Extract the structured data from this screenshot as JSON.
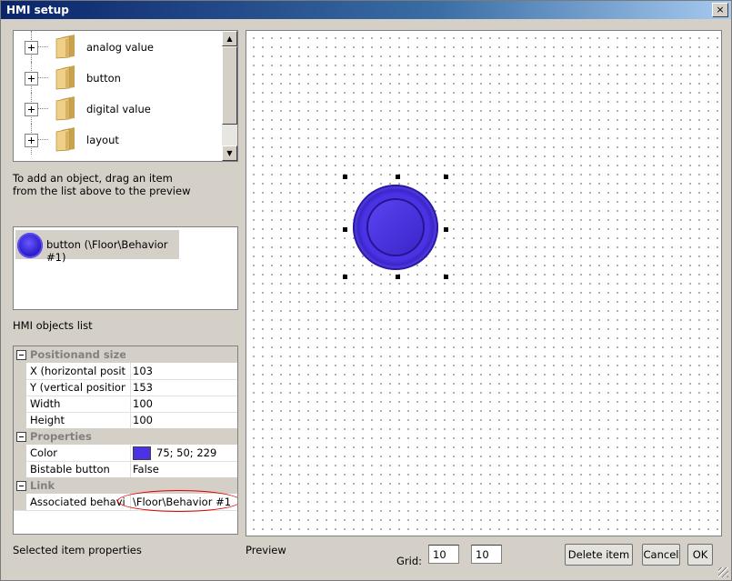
{
  "window": {
    "title": "HMI setup",
    "close_label": "×"
  },
  "tree": {
    "items": [
      {
        "label": "analog value",
        "icon": "folder-icon"
      },
      {
        "label": "button",
        "icon": "folder-icon"
      },
      {
        "label": "digital value",
        "icon": "folder-icon"
      },
      {
        "label": "layout",
        "icon": "folder-icon"
      }
    ]
  },
  "hint": "To add an object, drag an item from the list above to the preview",
  "objects_list": {
    "items": [
      {
        "label": "button (\\Floor\\Behavior #1)"
      }
    ],
    "caption": "HMI objects list"
  },
  "properties": {
    "categories": [
      {
        "label": "Positionand size",
        "rows": [
          {
            "name": "X (horizontal position",
            "value": "103"
          },
          {
            "name": "Y (vertical position)",
            "value": "153"
          },
          {
            "name": "Width",
            "value": "100"
          },
          {
            "name": "Height",
            "value": "100"
          }
        ]
      },
      {
        "label": "Properties",
        "rows": [
          {
            "name": "Color",
            "value": "75; 50; 229",
            "swatch": "#4b32e5"
          },
          {
            "name": "Bistable button",
            "value": "False"
          }
        ]
      },
      {
        "label": "Link",
        "rows": [
          {
            "name": "Associated behavior",
            "value": "\\Floor\\Behavior #1"
          }
        ]
      }
    ],
    "caption": "Selected item properties"
  },
  "preview": {
    "caption": "Preview",
    "button_color": "#4b32e5"
  },
  "grid": {
    "label": "Grid:",
    "x": "10",
    "y": "10"
  },
  "buttons": {
    "delete": "Delete item",
    "cancel": "Cancel",
    "ok": "OK"
  }
}
